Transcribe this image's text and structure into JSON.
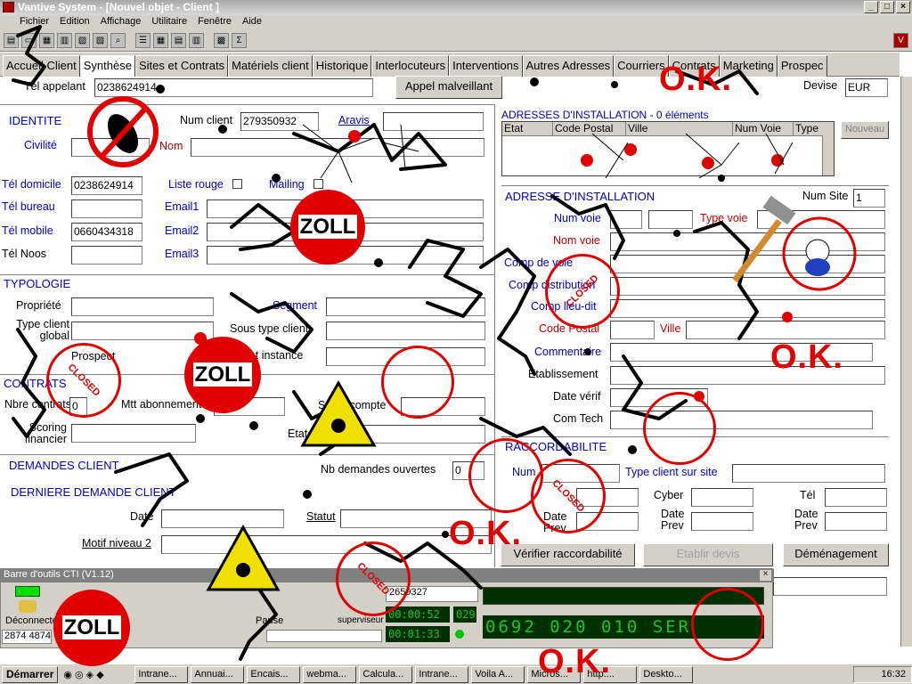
{
  "window": {
    "title": "Vantive System - [Nouvel objet - Client ]"
  },
  "menu": [
    "Fichier",
    "Edition",
    "Affichage",
    "Utilitaire",
    "Fenêtre",
    "Aide"
  ],
  "tabs": [
    "Accueil Client",
    "Synthèse",
    "Sites et Contrats",
    "Matériels client",
    "Historique",
    "Interlocuteurs",
    "Interventions",
    "Autres Adresses",
    "Courriers",
    "Contrats",
    "Marketing",
    "Prospec"
  ],
  "header": {
    "tel_appelant_label": "Tél appelant",
    "tel_appelant_value": "0238624914",
    "appel_button": "Appel malveillant",
    "devise_label": "Devise",
    "devise_value": "EUR"
  },
  "identite": {
    "section": "IDENTITE",
    "num_client_label": "Num client",
    "num_client_value": "279350932",
    "aravis_label": "Aravis",
    "civilite_label": "Civilité",
    "nom_label": "Nom",
    "tel_domicile_label": "Tél domicile",
    "tel_domicile_value": "0238624914",
    "liste_rouge_label": "Liste rouge",
    "mailing_label": "Mailing",
    "tel_bureau_label": "Tél bureau",
    "email1_label": "Email1",
    "tel_mobile_label": "Tél mobile",
    "tel_mobile_value": "0660434318",
    "email2_label": "Email2",
    "tel_noos_label": "Tél Noos",
    "email3_label": "Email3"
  },
  "typologie": {
    "section": "TYPOLOGIE",
    "propriete_label": "Propriété",
    "type_client_label": "Type client global",
    "prospect_label": "Prospect",
    "segment_label": "Segment",
    "sous_type_label": "Sous type client",
    "etat_instance_label": "Etat instance"
  },
  "contrats": {
    "section": "CONTRATS",
    "nb_contrats_label": "Nbre contrats",
    "nb_contrats_value": "0",
    "mtt_label": "Mtt abonnement",
    "solde_label": "Solde compte",
    "etat_label": "Etat",
    "scoring_label": "Scoring financier"
  },
  "demandes": {
    "section": "DEMANDES CLIENT",
    "nb_ouvertes_label": "Nb demandes ouvertes",
    "nb_ouvertes_value": "0",
    "derniere_section": "DERNIERE DEMANDE CLIENT",
    "date_label": "Date",
    "statut_label": "Statut",
    "motif_label": "Motif niveau 2"
  },
  "adresses": {
    "section": "ADRESSES D'INSTALLATION - 0 éléments",
    "nouveau_button": "Nouveau",
    "columns": [
      "Etat",
      "Code Postal",
      "Ville",
      "Num Voie",
      "Type"
    ],
    "adresse_section": "ADRESSE D'INSTALLATION",
    "num_site_label": "Num Site",
    "num_site_value": "1",
    "num_voie_label": "Num voie",
    "type_voie_label": "Type voie",
    "nom_voie_label": "Nom voie",
    "complement_label": "Comp de voie",
    "comp_distrib_label": "Comp distribution",
    "comp_lieu_label": "Comp lieu-dit",
    "code_postal_label": "Code Postal",
    "ville_label": "Ville",
    "commentaire_label": "Commentaire",
    "etablissement_label": "Etablissement",
    "date_verif_label": "Date vérif",
    "com_tech_label": "Com Tech"
  },
  "raccordabilite": {
    "section": "RACCORDABILITE",
    "num_label": "Num",
    "type_site_label": "Type client sur site",
    "cyber_label": "Cyber",
    "tel_label": "Tél",
    "date_prev_label": "Date Prev",
    "verifier_button": "Vérifier raccordabilité",
    "devis_button": "Etablir devis",
    "demenagement_button": "Déménagement"
  },
  "cti": {
    "title": "Barre d'outils CTI (V1.12)",
    "status": "Déconnecté",
    "ext": "2874 4874",
    "dial_value": "2659327",
    "supervisor_label": "superviseur",
    "pause_label": "Pause",
    "timer1": "00:00:52",
    "timer2": "00:01:33",
    "counter": "029",
    "lcd_text": "0692 020 010 SER"
  },
  "taskbar": {
    "start": "Démarrer",
    "items": [
      "Intrane...",
      "Annuai...",
      "Encais...",
      "webma...",
      "Calcula...",
      "Intrane...",
      "Voila A...",
      "Micros...",
      "http:...",
      "Deskto..."
    ],
    "clock": "16:32"
  },
  "stickers": {
    "zoll": "ZOLL",
    "ok": "O.K.",
    "closed": "CLOSED"
  },
  "colors": {
    "label_blue": "#0000c0",
    "label_red": "#c00000",
    "sticker_red": "#e00000",
    "window_grey": "#d4d0c8"
  }
}
